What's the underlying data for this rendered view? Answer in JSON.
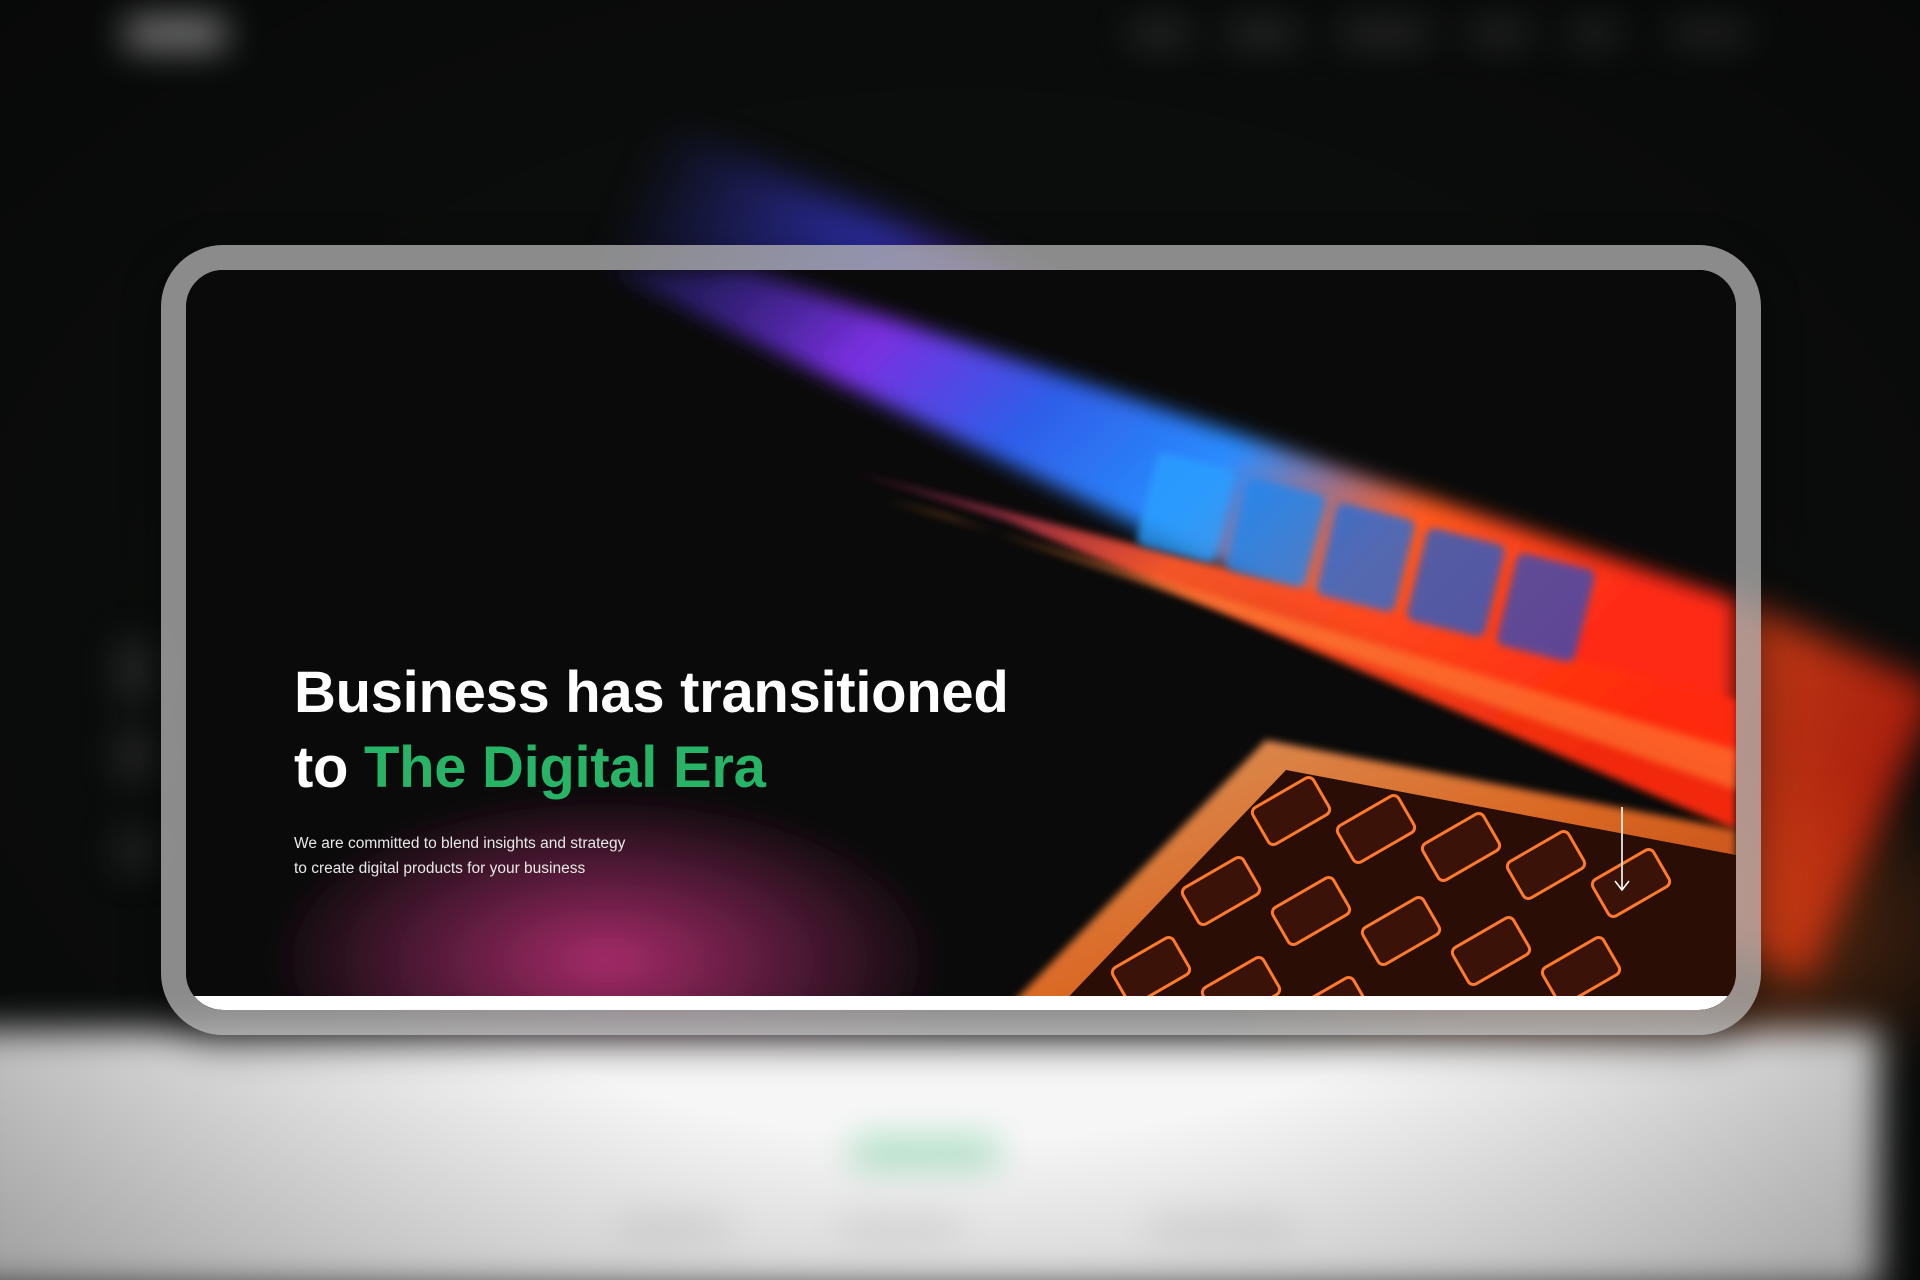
{
  "hero": {
    "title_line1": "Business has transitioned",
    "title_line2_prefix": "to ",
    "title_line2_accent": "The Digital Era",
    "subtitle_line1": "We are committed to blend insights and strategy",
    "subtitle_line2": "to create digital products for your business"
  },
  "icons": {
    "scroll": "arrow-down-icon"
  },
  "colors": {
    "accent": "#27b467",
    "background": "#0b0d0c",
    "text": "#ffffff"
  }
}
